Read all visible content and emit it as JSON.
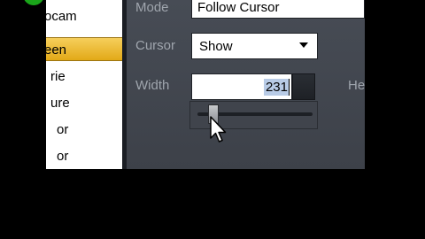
{
  "source_list": {
    "items": [
      {
        "label": "ocam"
      },
      {
        "label": "een"
      },
      {
        "label": "rie"
      },
      {
        "label": "ure"
      },
      {
        "label": "or"
      },
      {
        "label": "or"
      }
    ],
    "selected_index": 1,
    "selected_color": "#e9b52a"
  },
  "settings": {
    "mode_label": "Mode",
    "mode_value": "Follow Cursor",
    "cursor_label": "Cursor",
    "cursor_value": "Show",
    "width_label": "Width",
    "width_value": "231",
    "height_label_partial": "He"
  },
  "slider": {
    "value": 231,
    "level_fraction": 0.1
  },
  "icons": {
    "app": "green-circle-icon",
    "pointer": "mouse-pointer-icon",
    "dropdown": "chevron-down-icon"
  },
  "colors": {
    "panel_bg": "#434750",
    "label_text": "#9fa5ad",
    "selected_row": "#e9b52a"
  }
}
